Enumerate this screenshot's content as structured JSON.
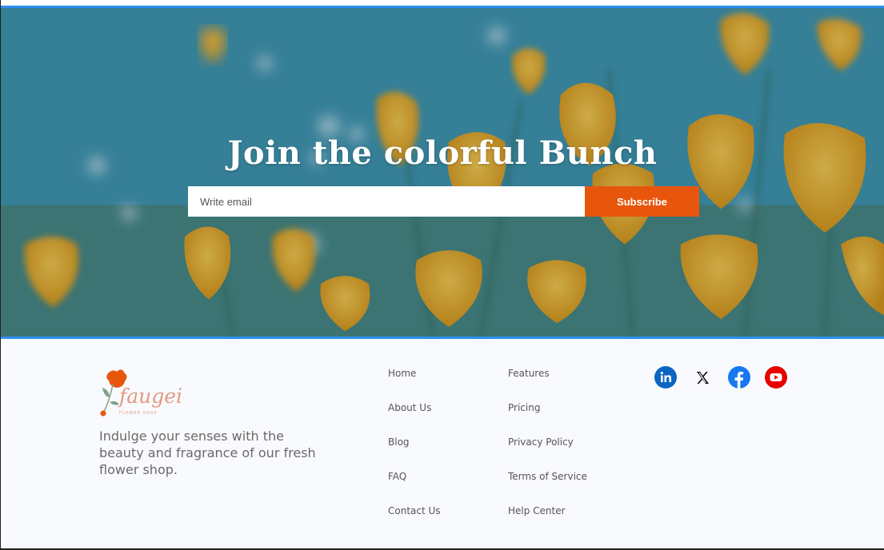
{
  "hero": {
    "title": "Join the colorful Bunch",
    "email_placeholder": "Write email",
    "subscribe_label": "Subscribe"
  },
  "footer": {
    "logo": {
      "brand": "faugei",
      "sub": "FLOWER SHOP"
    },
    "tagline": "Indulge your senses with the beauty and fragrance of our fresh flower shop.",
    "links_col1": [
      "Home",
      "About Us",
      "Blog",
      "FAQ",
      "Contact Us"
    ],
    "links_col2": [
      "Features",
      "Pricing",
      "Privacy Policy",
      "Terms of Service",
      "Help Center"
    ],
    "social": [
      {
        "name": "linkedin-icon",
        "color": "#0a66c2"
      },
      {
        "name": "x-icon",
        "color": "#000000"
      },
      {
        "name": "facebook-icon",
        "color": "#1877f2"
      },
      {
        "name": "youtube-icon",
        "color": "#e60000"
      }
    ]
  },
  "colors": {
    "accent": "#e8560d",
    "frame": "#2d8ff0"
  }
}
